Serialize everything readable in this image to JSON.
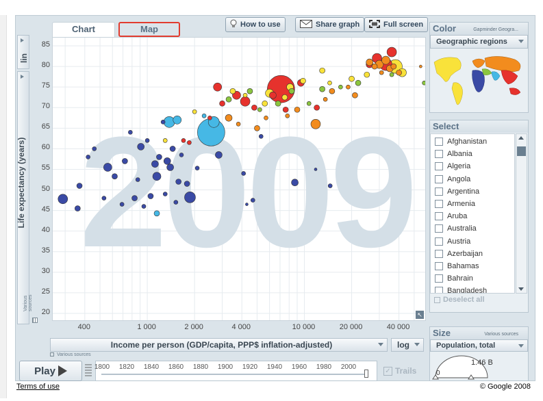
{
  "tabs": {
    "chart": "Chart",
    "map": "Map"
  },
  "toolbar": {
    "how_to_use": "How to use",
    "share_graph": "Share graph",
    "full_screen": "Full screen"
  },
  "scale_y": "lin",
  "scale_x": "log",
  "y_axis_label": "Life expectancy (years)",
  "x_axis_label": "Income per person (GDP/capita, PPP$ inflation-adjusted)",
  "various_sources_y": "Various sources",
  "various_sources_x": "Various sources",
  "year_watermark": "2009",
  "color_panel": {
    "title": "Color",
    "source": "Gapminder Geogra...",
    "selected": "Geographic regions"
  },
  "select_panel": {
    "title": "Select",
    "countries": [
      "Afghanistan",
      "Albania",
      "Algeria",
      "Angola",
      "Argentina",
      "Armenia",
      "Aruba",
      "Australia",
      "Austria",
      "Azerbaijan",
      "Bahamas",
      "Bahrain",
      "Bangladesh"
    ],
    "deselect_all": "Deselect all"
  },
  "size_panel": {
    "title": "Size",
    "source": "Various sources",
    "selected": "Population, total",
    "min": "0",
    "max": "1.46 B"
  },
  "play": {
    "label": "Play",
    "trails": "Trails",
    "years": [
      "1800",
      "1820",
      "1840",
      "1860",
      "1880",
      "1900",
      "1920",
      "1940",
      "1960",
      "1980",
      "2000"
    ]
  },
  "footer": {
    "terms": "Terms of use",
    "copyright": "© Google 2008"
  },
  "colors": {
    "africa": "#3a4aa5",
    "americas": "#f9e23a",
    "europe_asia_c": "#f28c1e",
    "east_asia": "#e6322d",
    "south_asia": "#46b8e5",
    "middle_east": "#8bc53f"
  },
  "chart_data": {
    "type": "scatter",
    "xlabel": "Income per person (GDP/capita, PPP$ inflation-adjusted)",
    "ylabel": "Life expectancy (years)",
    "x_scale": "log",
    "xlim": [
      250,
      60000
    ],
    "ylim": [
      18,
      87
    ],
    "x_ticks": [
      400,
      1000,
      2000,
      4000,
      10000,
      20000,
      40000
    ],
    "x_tick_labels": [
      "400",
      "1 000",
      "2 000",
      "4 000",
      "10 000",
      "20 000",
      "40 000"
    ],
    "y_ticks": [
      20,
      25,
      30,
      35,
      40,
      45,
      50,
      55,
      60,
      65,
      70,
      75,
      80,
      85
    ],
    "points": [
      [
        290,
        47.8,
        7,
        "africa"
      ],
      [
        360,
        45.5,
        4,
        "africa"
      ],
      [
        370,
        51,
        4,
        "africa"
      ],
      [
        420,
        58,
        3,
        "africa"
      ],
      [
        460,
        60,
        3,
        "africa"
      ],
      [
        530,
        48,
        3,
        "africa"
      ],
      [
        560,
        55.5,
        6,
        "africa"
      ],
      [
        620,
        53.3,
        4,
        "africa"
      ],
      [
        690,
        46.5,
        3,
        "africa"
      ],
      [
        720,
        57,
        4,
        "africa"
      ],
      [
        780,
        64,
        3,
        "africa"
      ],
      [
        830,
        48,
        4,
        "africa"
      ],
      [
        870,
        52.5,
        3,
        "africa"
      ],
      [
        910,
        60.5,
        5,
        "africa"
      ],
      [
        950,
        46,
        3,
        "africa"
      ],
      [
        1000,
        62,
        3,
        "africa"
      ],
      [
        1050,
        48.5,
        4,
        "africa"
      ],
      [
        1120,
        56.3,
        5,
        "africa"
      ],
      [
        1150,
        53.3,
        6,
        "africa"
      ],
      [
        1190,
        58,
        4,
        "africa"
      ],
      [
        1260,
        66.5,
        3,
        "africa"
      ],
      [
        1300,
        49,
        3,
        "africa"
      ],
      [
        1340,
        57,
        5,
        "africa"
      ],
      [
        1400,
        55.5,
        5,
        "africa"
      ],
      [
        1450,
        60,
        4,
        "africa"
      ],
      [
        1520,
        47,
        3,
        "africa"
      ],
      [
        1580,
        52,
        4,
        "africa"
      ],
      [
        1650,
        58.5,
        3,
        "africa"
      ],
      [
        1790,
        51.5,
        4,
        "africa"
      ],
      [
        1870,
        48.2,
        8,
        "africa"
      ],
      [
        2080,
        55.3,
        3,
        "africa"
      ],
      [
        2850,
        58.5,
        5,
        "africa"
      ],
      [
        4100,
        54,
        3,
        "africa"
      ],
      [
        4700,
        47.5,
        3,
        "africa"
      ],
      [
        5300,
        63,
        3,
        "africa"
      ],
      [
        8700,
        51.8,
        5,
        "africa"
      ],
      [
        14600,
        51,
        3,
        "africa"
      ],
      [
        11800,
        55,
        2,
        "africa"
      ],
      [
        4300,
        46.5,
        2,
        "africa"
      ],
      [
        1380,
        66.5,
        8,
        "south_asia"
      ],
      [
        1150,
        44.3,
        4,
        "south_asia"
      ],
      [
        2550,
        64,
        20,
        "south_asia"
      ],
      [
        2300,
        68,
        3,
        "south_asia"
      ],
      [
        1550,
        67,
        6,
        "south_asia"
      ],
      [
        2650,
        66.5,
        8,
        "south_asia"
      ],
      [
        1700,
        62,
        3,
        "east_asia"
      ],
      [
        1850,
        61.5,
        3,
        "east_asia"
      ],
      [
        2500,
        67.5,
        3,
        "east_asia"
      ],
      [
        2800,
        75,
        6,
        "east_asia"
      ],
      [
        3000,
        71,
        4,
        "east_asia"
      ],
      [
        3700,
        73,
        6,
        "east_asia"
      ],
      [
        4200,
        71.5,
        7,
        "east_asia"
      ],
      [
        4800,
        70,
        4,
        "east_asia"
      ],
      [
        6300,
        73,
        5,
        "east_asia"
      ],
      [
        7100,
        74.5,
        20,
        "east_asia"
      ],
      [
        7600,
        69.5,
        4,
        "east_asia"
      ],
      [
        9500,
        76,
        5,
        "east_asia"
      ],
      [
        12000,
        70,
        4,
        "east_asia"
      ],
      [
        29000,
        82,
        7,
        "east_asia"
      ],
      [
        33000,
        80.5,
        9,
        "east_asia"
      ],
      [
        36000,
        83.5,
        7,
        "east_asia"
      ],
      [
        26000,
        80.5,
        5,
        "east_asia"
      ],
      [
        3300,
        72,
        4,
        "middle_east"
      ],
      [
        4500,
        74,
        4,
        "middle_east"
      ],
      [
        5200,
        69.5,
        3,
        "middle_east"
      ],
      [
        6800,
        71,
        4,
        "middle_east"
      ],
      [
        8300,
        74,
        4,
        "middle_east"
      ],
      [
        10700,
        71,
        3,
        "middle_east"
      ],
      [
        13000,
        74.5,
        4,
        "middle_east"
      ],
      [
        17000,
        75,
        3,
        "middle_east"
      ],
      [
        22000,
        76,
        4,
        "middle_east"
      ],
      [
        36000,
        78,
        3,
        "middle_east"
      ],
      [
        58000,
        76,
        3,
        "middle_east"
      ],
      [
        1300,
        62,
        3,
        "americas"
      ],
      [
        2000,
        69,
        3,
        "americas"
      ],
      [
        3500,
        74,
        4,
        "americas"
      ],
      [
        4200,
        73,
        3,
        "americas"
      ],
      [
        5600,
        71,
        4,
        "americas"
      ],
      [
        6000,
        73.5,
        6,
        "americas"
      ],
      [
        7500,
        72.5,
        4,
        "americas"
      ],
      [
        8100,
        75,
        5,
        "americas"
      ],
      [
        9800,
        76.5,
        4,
        "americas"
      ],
      [
        13000,
        79,
        4,
        "americas"
      ],
      [
        14500,
        76,
        3,
        "americas"
      ],
      [
        20000,
        77,
        4,
        "americas"
      ],
      [
        25000,
        78,
        4,
        "americas"
      ],
      [
        38000,
        80,
        10,
        "americas"
      ],
      [
        42000,
        78.5,
        6,
        "americas"
      ],
      [
        3300,
        67.5,
        5,
        "europe_asia_c"
      ],
      [
        3800,
        66,
        3,
        "europe_asia_c"
      ],
      [
        5000,
        65,
        4,
        "europe_asia_c"
      ],
      [
        5700,
        67.5,
        3,
        "europe_asia_c"
      ],
      [
        7800,
        68,
        3,
        "europe_asia_c"
      ],
      [
        9000,
        69.5,
        4,
        "europe_asia_c"
      ],
      [
        11800,
        66,
        7,
        "europe_asia_c"
      ],
      [
        13600,
        72,
        3,
        "europe_asia_c"
      ],
      [
        15000,
        74,
        4,
        "europe_asia_c"
      ],
      [
        19000,
        75,
        3,
        "europe_asia_c"
      ],
      [
        21000,
        73,
        4,
        "europe_asia_c"
      ],
      [
        26000,
        81,
        5,
        "europe_asia_c"
      ],
      [
        30000,
        80.5,
        6,
        "europe_asia_c"
      ],
      [
        33000,
        81.5,
        6,
        "europe_asia_c"
      ],
      [
        35000,
        79.5,
        5,
        "europe_asia_c"
      ],
      [
        37000,
        80,
        4,
        "europe_asia_c"
      ],
      [
        40000,
        78.5,
        4,
        "europe_asia_c"
      ],
      [
        55000,
        80,
        2,
        "europe_asia_c"
      ],
      [
        28000,
        80,
        4,
        "europe_asia_c"
      ],
      [
        31000,
        78.5,
        3,
        "europe_asia_c"
      ]
    ]
  }
}
